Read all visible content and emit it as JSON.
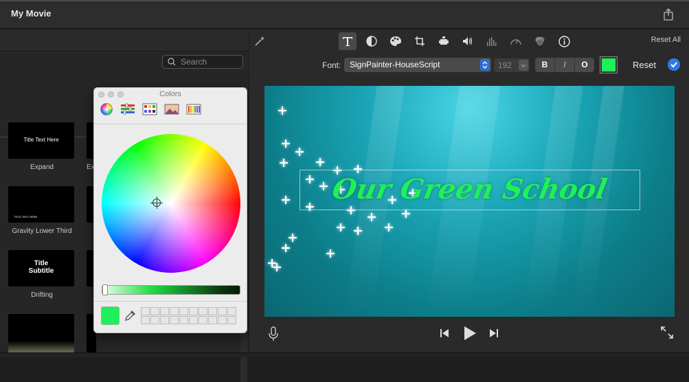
{
  "window": {
    "title": "My Movie"
  },
  "browser": {
    "search_placeholder": "Search",
    "titles": [
      {
        "preview_text": "Title Text Here",
        "label": "Expand"
      },
      {
        "preview_text": "TITLE TEXT HERE",
        "label": "Gravity Lower Third"
      },
      {
        "preview_text": "Title\nSubtitle",
        "label": "Drifting"
      }
    ],
    "partial_label": "Ex"
  },
  "colors_panel": {
    "title": "Colors",
    "current_color": "#1ef05a"
  },
  "toolbar": {
    "reset_all": "Reset All",
    "font_label": "Font:",
    "font_name": "SignPainter-HouseScript",
    "font_size": "192",
    "bold": "B",
    "italic": "I",
    "outline": "O",
    "text_color": "#1ef05a",
    "reset": "Reset"
  },
  "viewer": {
    "title_text": "Our Green School"
  }
}
